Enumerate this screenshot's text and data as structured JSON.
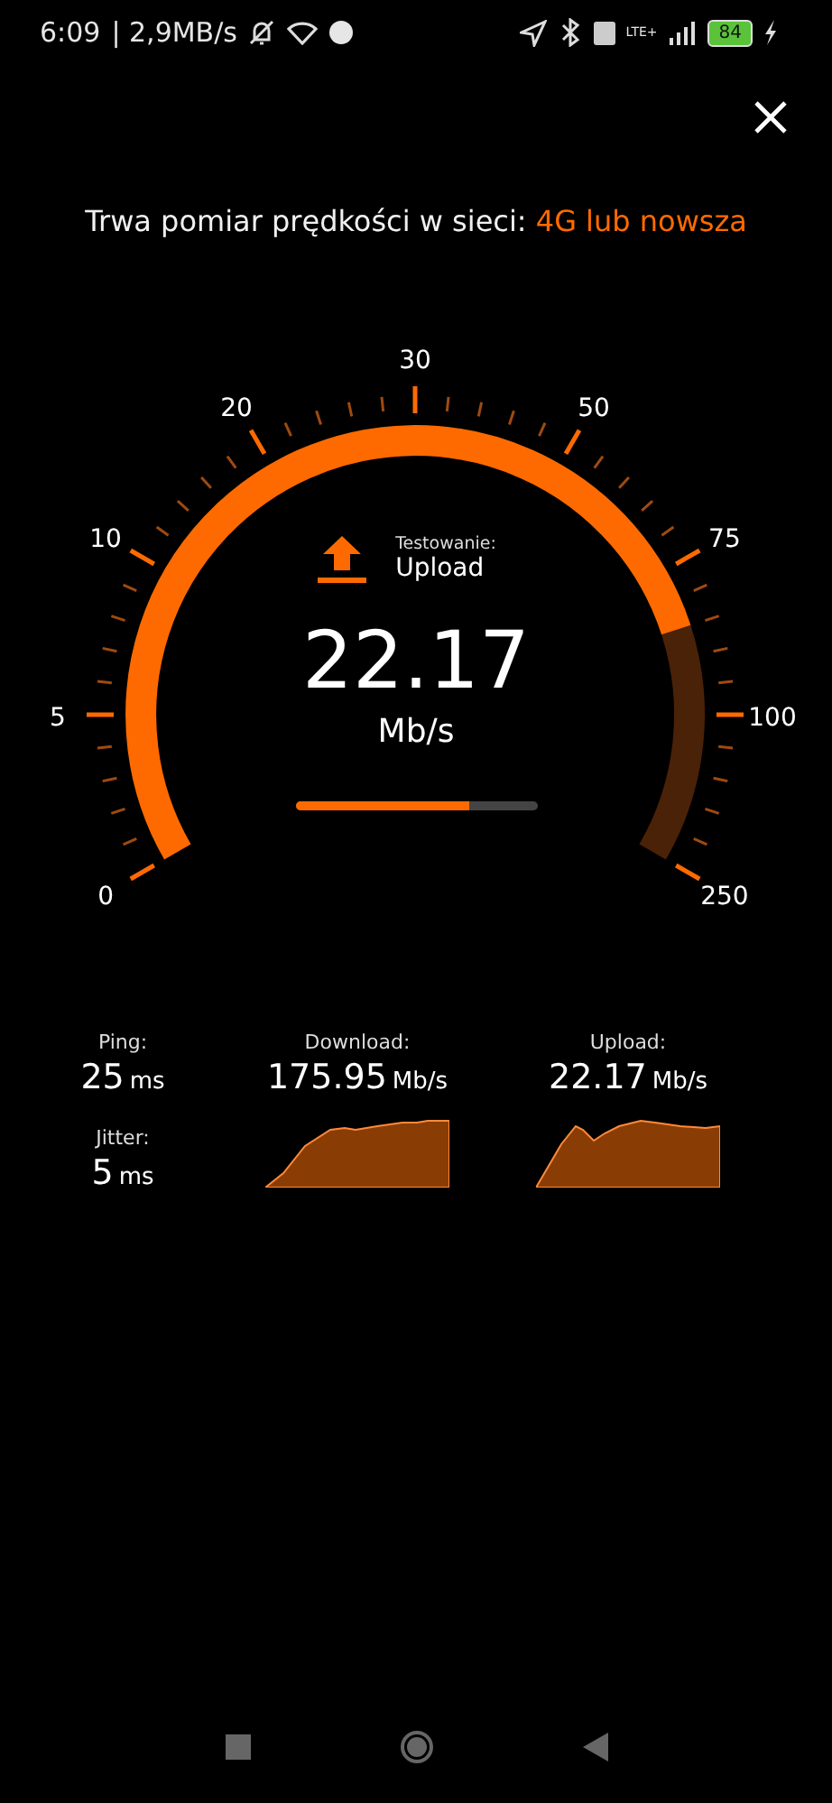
{
  "status_bar": {
    "time": "6:09",
    "speed": "| 2,9MB/s",
    "network": "LTE+",
    "battery": "84"
  },
  "title": {
    "text": "Trwa pomiar prędkości w sieci: ",
    "network": "4G lub nowsza"
  },
  "gauge": {
    "scale": [
      "0",
      "5",
      "10",
      "20",
      "30",
      "50",
      "75",
      "100",
      "250"
    ],
    "phase_label": "Testowanie:",
    "phase": "Upload",
    "value": "22.17",
    "unit": "Mb/s"
  },
  "progress": {
    "level": 0.72
  },
  "stats": {
    "ping": {
      "label": "Ping:",
      "value": "25",
      "unit": "ms"
    },
    "jitter": {
      "label": "Jitter:",
      "value": "5",
      "unit": "ms"
    },
    "download": {
      "label": "Download:",
      "value": "175.95",
      "unit": "Mb/s"
    },
    "upload": {
      "label": "Upload:",
      "value": "22.17",
      "unit": "Mb/s"
    }
  }
}
